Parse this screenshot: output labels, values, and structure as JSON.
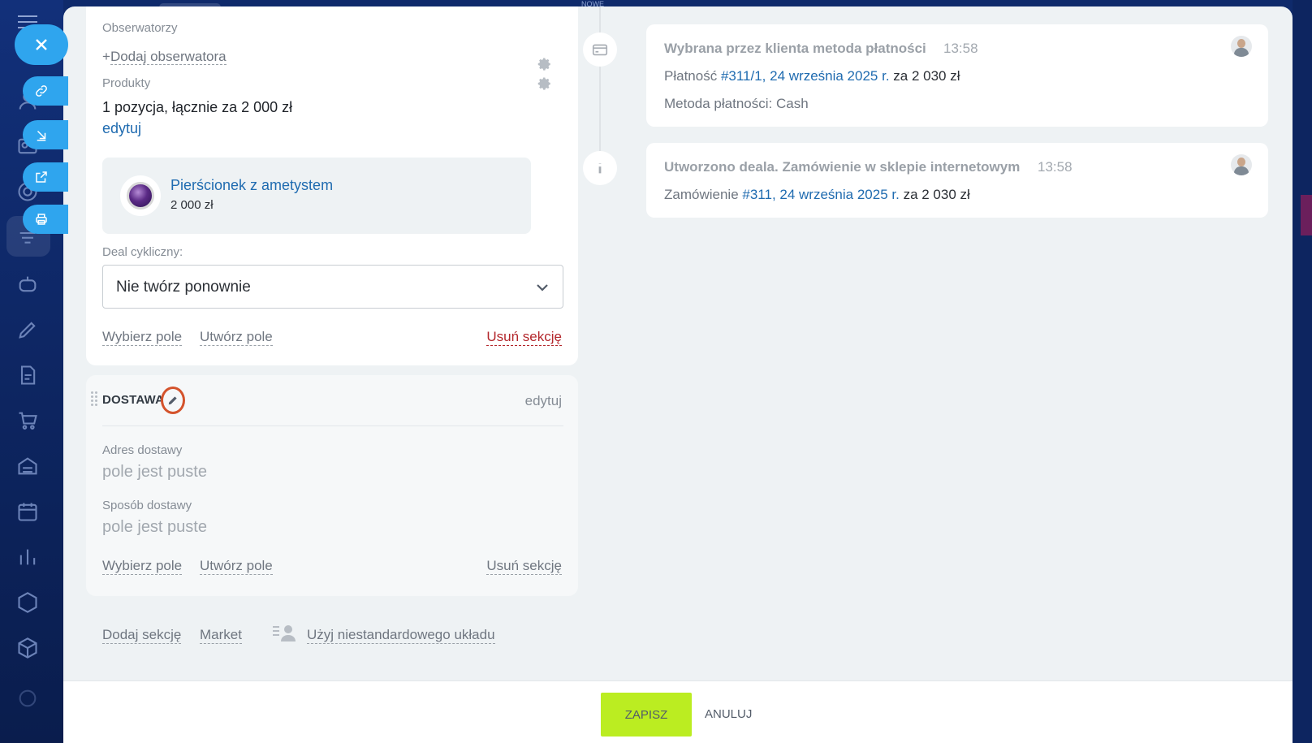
{
  "top": {
    "mini_label": "NOWE"
  },
  "deal": {
    "observers_label": "Obserwatorzy",
    "add_observer": "Dodaj obserwatora",
    "add_observer_plus": "+",
    "products_label": "Produkty",
    "products_summary": "1 pozycja, łącznie za 2 000 zł",
    "products_edit": "edytuj",
    "product": {
      "name": "Pierścionek z ametystem",
      "price": "2 000 zł"
    },
    "recurring_label": "Deal cykliczny:",
    "recurring_value": "Nie twórz ponownie",
    "select_field": "Wybierz pole",
    "create_field": "Utwórz pole",
    "delete_section": "Usuń sekcję"
  },
  "delivery": {
    "title": "DOSTAWA",
    "edit": "edytuj",
    "address_label": "Adres dostawy",
    "address_value": "pole jest puste",
    "method_label": "Sposób dostawy",
    "method_value": "pole jest puste",
    "select_field": "Wybierz pole",
    "create_field": "Utwórz pole",
    "delete_section": "Usuń sekcję"
  },
  "bottom_links": {
    "add_section": "Dodaj sekcję",
    "market": "Market",
    "custom_layout": "Użyj niestandardowego układu"
  },
  "timeline": [
    {
      "title": "Wybrana przez klienta metoda płatności",
      "time": "13:58",
      "line1_prefix": "Płatność",
      "line1_link": "#311/1, 24 września 2025 r.",
      "line1_suffix": "za 2 030 zł",
      "line2": "Metoda płatności: Cash",
      "icon": "card-icon"
    },
    {
      "title": "Utworzono deala. Zamówienie w sklepie internetowym",
      "time": "13:58",
      "line1_prefix": "Zamówienie",
      "line1_link": "#311, 24 września 2025 r.",
      "line1_suffix": "za 2 030 zł",
      "icon": "info-icon"
    }
  ],
  "footer": {
    "save": "ZAPISZ",
    "cancel": "ANULUJ"
  },
  "colors": {
    "accent": "#2fa5ee",
    "save_button": "#bbed21",
    "link": "#1f6bb0",
    "danger": "#b3262b",
    "highlight_ring": "#d4532c"
  }
}
